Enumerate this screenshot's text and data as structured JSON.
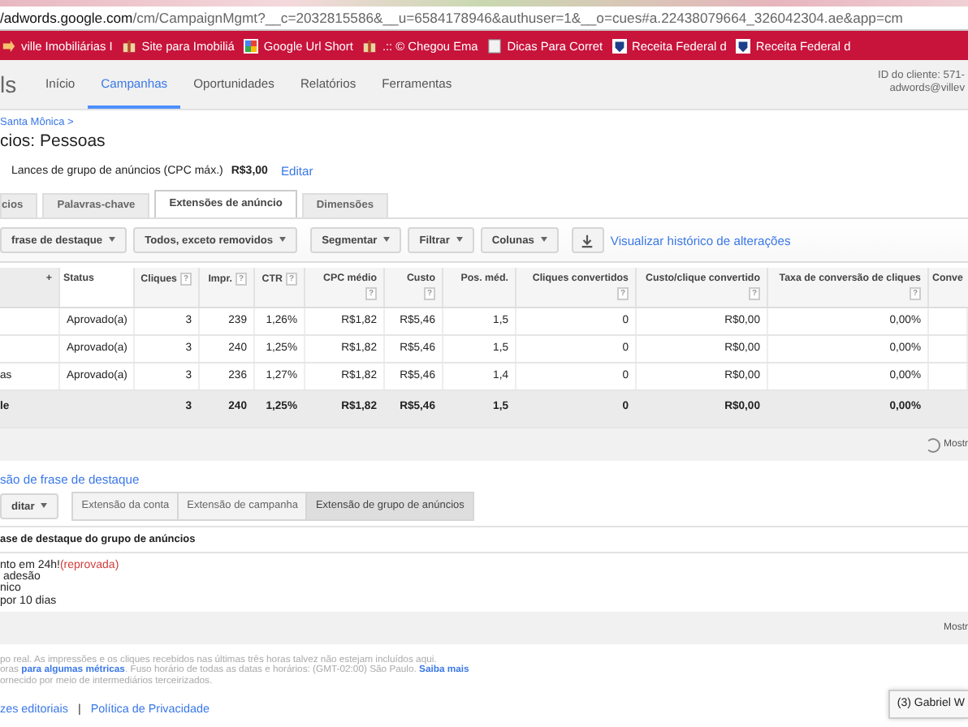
{
  "address_bar": {
    "host": "/adwords.google.com",
    "path": "/cm/CampaignMgmt?__c=2032815586&__u=6584178946&authuser=1&__o=cues#a.22438079664_326042304.ae&app=cm"
  },
  "bookmarks": [
    {
      "label": "ville Imobiliárias I",
      "kind": "arrow"
    },
    {
      "label": "Site para Imobiliá",
      "kind": "gift"
    },
    {
      "label": "Google Url Short",
      "kind": "squares"
    },
    {
      "label": ".:: © Chegou Ema",
      "kind": "gift"
    },
    {
      "label": "Dicas Para Corret",
      "kind": "page"
    },
    {
      "label": "Receita Federal d",
      "kind": "shield"
    },
    {
      "label": "Receita Federal d",
      "kind": "shield"
    }
  ],
  "nav": {
    "logo": "ls",
    "items": [
      {
        "label": "Início",
        "selected": false
      },
      {
        "label": "Campanhas",
        "selected": true
      },
      {
        "label": "Oportunidades",
        "selected": false
      },
      {
        "label": "Relatórios",
        "selected": false
      },
      {
        "label": "Ferramentas",
        "selected": false
      }
    ],
    "client_id": "ID do cliente: 571-",
    "account": "adwords@villev"
  },
  "breadcrumb": "Santa Mônica >",
  "title": "cios: Pessoas",
  "bid": {
    "label": "Lances de grupo de anúncios (CPC máx.)",
    "value": "R$3,00",
    "action": "Editar"
  },
  "tabs": [
    {
      "label": "cios",
      "selected": false
    },
    {
      "label": "Palavras-chave",
      "selected": false
    },
    {
      "label": "Extensões de anúncio",
      "selected": true
    },
    {
      "label": "Dimensões",
      "selected": false
    }
  ],
  "toolbar": {
    "dropdowns": [
      "frase de destaque",
      "Todos, exceto removidos",
      "Segmentar",
      "Filtrar",
      "Colunas"
    ],
    "history_link": "Visualizar histórico de alterações"
  },
  "table": {
    "columns": [
      {
        "label": "+"
      },
      {
        "label": "Status"
      },
      {
        "label": "Cliques",
        "help": "?"
      },
      {
        "label": "Impr.",
        "help": "?"
      },
      {
        "label": "CTR",
        "help": "?"
      },
      {
        "label": "CPC médio",
        "help": "?"
      },
      {
        "label": "Custo",
        "help": "?"
      },
      {
        "label": "Pos. méd."
      },
      {
        "label": "Cliques convertidos",
        "help": "?"
      },
      {
        "label": "Custo/clique convertido",
        "help": "?"
      },
      {
        "label": "Taxa de conversão de cliques",
        "help": "?"
      },
      {
        "label": "Conve"
      }
    ],
    "rows": [
      {
        "kind": "row",
        "status": "Aprovado(a)",
        "values": [
          "3",
          "239",
          "1,26%",
          "R$1,82",
          "R$5,46",
          "1,5",
          "0",
          "R$0,00",
          "0,00%"
        ]
      },
      {
        "kind": "row",
        "status": "Aprovado(a)",
        "values": [
          "3",
          "240",
          "1,25%",
          "R$1,82",
          "R$5,46",
          "1,5",
          "0",
          "R$0,00",
          "0,00%"
        ]
      },
      {
        "kind": "row",
        "column_1": "as",
        "status": "Aprovado(a)",
        "values": [
          "3",
          "236",
          "1,27%",
          "R$1,82",
          "R$5,46",
          "1,4",
          "0",
          "R$0,00",
          "0,00%"
        ]
      },
      {
        "kind": "total",
        "column_1": "le",
        "values": [
          "3",
          "240",
          "1,25%",
          "R$1,82",
          "R$5,46",
          "1,5",
          "0",
          "R$0,00",
          "0,00%"
        ]
      }
    ],
    "footer": "Mostr"
  },
  "callout_section": {
    "link": "são de frase de destaque",
    "edit_button": "ditar",
    "level_tabs": [
      {
        "label": "Extensão da conta",
        "selected": false
      },
      {
        "label": "Extensão de campanha",
        "selected": false
      },
      {
        "label": "Extensão de grupo de anúncios",
        "selected": true
      }
    ],
    "header": "ase de destaque do grupo de anúncios",
    "items": [
      {
        "text": "nto em 24h!",
        "status": "(reprovada)"
      },
      {
        "text": " adesão"
      },
      {
        "text": "nico"
      },
      {
        "text": "por 10 dias"
      }
    ],
    "footer": "Mostr"
  },
  "notes": [
    [
      {
        "kind": "text",
        "text": "po real. As impressões e os cliques recebidos nas últimas três horas talvez não estejam incluídos aqui."
      }
    ],
    [
      {
        "kind": "text",
        "text": "oras "
      },
      {
        "kind": "link",
        "text": "para algumas métricas"
      },
      {
        "kind": "text",
        "text": ". Fuso horário de todas as datas e horários: (GMT-02:00) São Paulo. "
      },
      {
        "kind": "link",
        "text": "Saiba mais"
      }
    ],
    [
      {
        "kind": "text",
        "text": "ornecido por meio de intermediários terceirizados."
      }
    ]
  ],
  "footer_links": [
    "zes editoriais",
    "Política de Privacidade"
  ],
  "footer_separator": "|",
  "chat_tab": "(3) Gabriel W"
}
